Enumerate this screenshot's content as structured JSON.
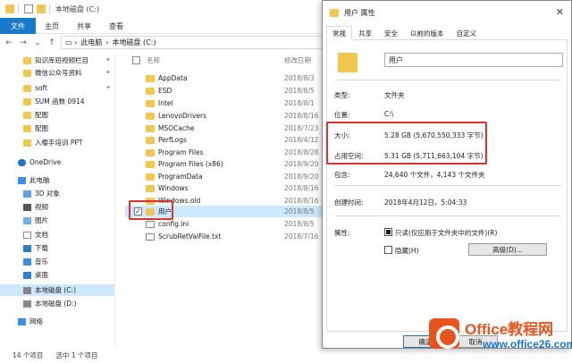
{
  "explorer": {
    "title": "本地磁盘 (C:)",
    "ribbon_tabs": [
      "文件",
      "主页",
      "共享",
      "查看"
    ],
    "breadcrumb": [
      "此电脑",
      "本地磁盘 (C:)"
    ],
    "nav_icons": [
      "back-arrow-icon",
      "forward-arrow-icon",
      "chevron-down-icon",
      "up-arrow-icon"
    ],
    "quick_access": [
      {
        "label": "知识库短视频栏目",
        "pinned": true
      },
      {
        "label": "微信公众号资料",
        "pinned": true
      },
      {
        "label": "soft",
        "pinned": true
      },
      {
        "label": "SUM 函数 0914",
        "pinned": false
      },
      {
        "label": "配图",
        "pinned": false
      },
      {
        "label": "配图",
        "pinned": false
      },
      {
        "label": "入樱手培训 PPT",
        "pinned": false
      }
    ],
    "onedrive": "OneDrive",
    "this_pc": "此电脑",
    "pc_items": [
      "3D 对象",
      "视频",
      "图片",
      "文档",
      "下载",
      "音乐",
      "桌面",
      "本地磁盘 (C:)",
      "本地磁盘 (D:)"
    ],
    "network": "网络",
    "columns": {
      "name": "名称",
      "date": "修改日期"
    },
    "files": [
      {
        "name": "AppData",
        "date": "2018/8/3",
        "type": "folder"
      },
      {
        "name": "ESD",
        "date": "2018/8/5",
        "type": "folder"
      },
      {
        "name": "Intel",
        "date": "2018/8/1",
        "type": "folder"
      },
      {
        "name": "LenovoDrivers",
        "date": "2018/8/16",
        "type": "folder"
      },
      {
        "name": "MSOCache",
        "date": "2018/7/23",
        "type": "folder"
      },
      {
        "name": "PerfLogs",
        "date": "2018/4/12",
        "type": "folder"
      },
      {
        "name": "Program Files",
        "date": "2018/8/28",
        "type": "folder"
      },
      {
        "name": "Program Files (x86)",
        "date": "2018/9/20",
        "type": "folder"
      },
      {
        "name": "ProgramData",
        "date": "2018/9/20",
        "type": "folder"
      },
      {
        "name": "Windows",
        "date": "2018/8/16",
        "type": "folder"
      },
      {
        "name": "Windows.old",
        "date": "2018/8/16",
        "type": "folder"
      },
      {
        "name": "用户",
        "date": "2018/8/5",
        "type": "folder",
        "selected": true
      },
      {
        "name": "config.ini",
        "date": "2018/8/5",
        "type": "file"
      },
      {
        "name": "ScrubRetValFile.txt",
        "date": "2018/7/16",
        "type": "file"
      }
    ],
    "status": {
      "count": "14 个项目",
      "selected": "选中 1 个项目"
    }
  },
  "dialog": {
    "title": "用户 属性",
    "close": "✕",
    "tabs": [
      "常规",
      "共享",
      "安全",
      "以前的版本",
      "自定义"
    ],
    "name_value": "用户",
    "type_label": "类型:",
    "type_value": "文件夹",
    "location_label": "位置:",
    "location_value": "C:\\",
    "size_label": "大小:",
    "size_value": "5.28 GB (5,670,550,333 字节)",
    "disk_label": "占用空间:",
    "disk_value": "5.31 GB (5,711,663,104 字节)",
    "contains_label": "包含:",
    "contains_value": "24,640 个文件，4,143 个文件夹",
    "created_label": "创建时间:",
    "created_value": "2018年4月12日，5:04:33",
    "attr_label": "属性:",
    "readonly_label": "只读(仅应用于文件夹中的文件)(R)",
    "hidden_label": "隐藏(H)",
    "advanced_button": "高级(D)...",
    "ok_button": "确定",
    "cancel_button": "取消"
  },
  "watermark": {
    "line1": "Office教程网",
    "line2": "www.office26.com"
  },
  "colors": {
    "accent": "#1979ca",
    "highlight": "#d9312b",
    "folder": "#f3c74d",
    "selection": "#cce8ff"
  }
}
